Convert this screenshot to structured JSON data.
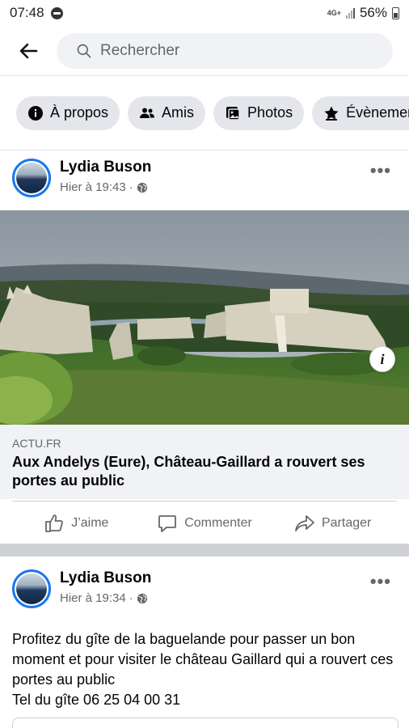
{
  "status_bar": {
    "time": "07:48",
    "network": "4G+",
    "battery": "56%"
  },
  "search": {
    "placeholder": "Rechercher"
  },
  "chips": [
    {
      "label": "À propos",
      "icon": "info-icon"
    },
    {
      "label": "Amis",
      "icon": "friends-icon"
    },
    {
      "label": "Photos",
      "icon": "photos-icon"
    },
    {
      "label": "Évènements",
      "icon": "star-icon"
    }
  ],
  "posts": [
    {
      "author": "Lydia Buson",
      "time": "Hier à 19:43",
      "link": {
        "source": "ACTU.FR",
        "title": "Aux Andelys (Eure), Château-Gaillard a rouvert ses portes au public"
      },
      "actions": {
        "like": "J’aime",
        "comment": "Commenter",
        "share": "Partager"
      }
    },
    {
      "author": "Lydia Buson",
      "time": "Hier à 19:34",
      "text": "Profitez du gîte de la baguelande pour  passer  un bon moment  et pour  visiter le  château  Gaillard  qui a rouvert  ces portes  au public\nTel du gîte  06 25 04 00 31"
    }
  ],
  "colors": {
    "accent": "#1877f2",
    "chip_bg": "#e4e6eb",
    "secondary_text": "#65676b",
    "link_box_bg": "#f0f2f5"
  }
}
